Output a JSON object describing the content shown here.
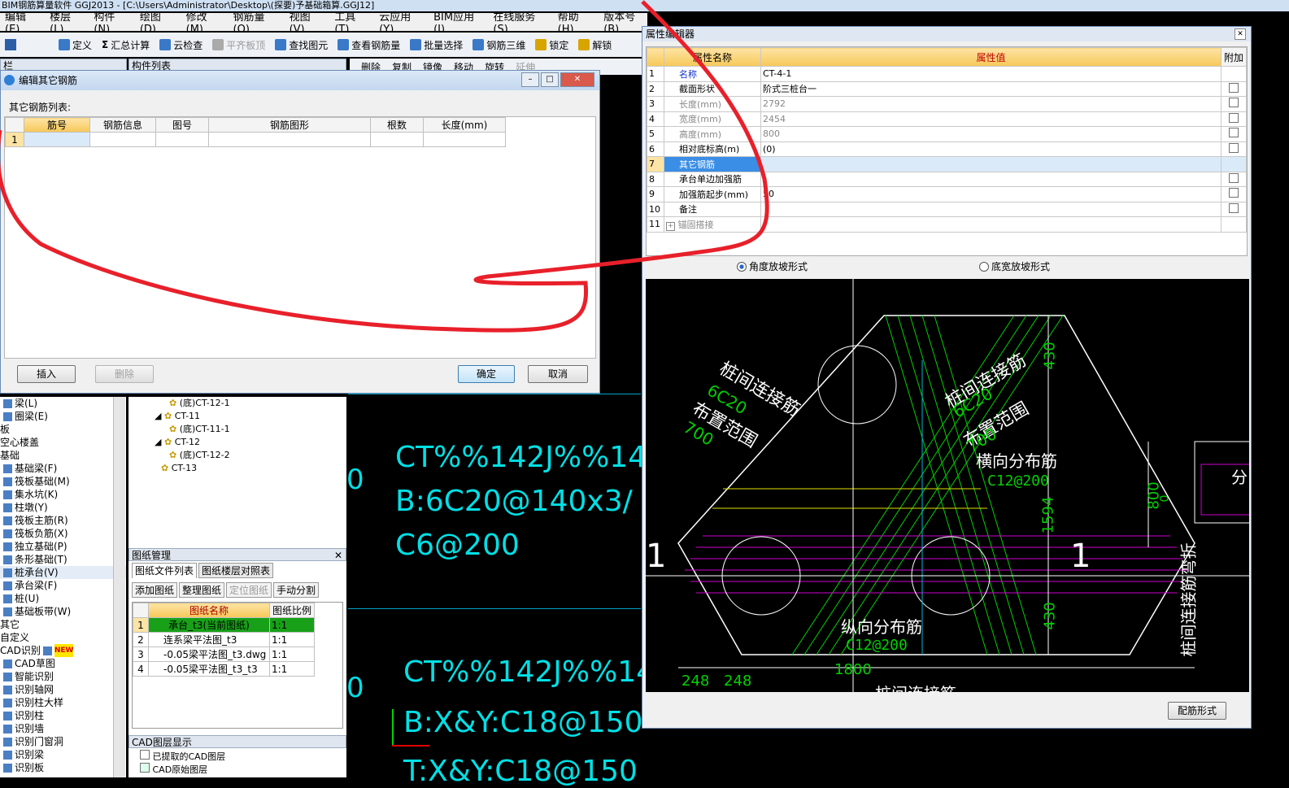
{
  "window_title": "BIM钢筋算量软件 GGJ2013 - [C:\\Users\\Administrator\\Desktop\\(探要)予基础箱算.GGJ12]",
  "menu": [
    "编辑(E)",
    "楼层(L)",
    "构件(N)",
    "绘图(D)",
    "修改(M)",
    "钢筋量(Q)",
    "视图(V)",
    "工具(T)",
    "云应用(Y)",
    "BIM应用(I)",
    "在线服务(S)",
    "帮助(H)",
    "版本号(B)"
  ],
  "toolbar": [
    "定义",
    "汇总计算",
    "云检查",
    "平齐板顶",
    "查找图元",
    "查看钢筋量",
    "批量选择",
    "钢筋三维",
    "锁定",
    "解锁"
  ],
  "toolbar2": [
    "删除",
    "复制",
    "镜像",
    "移动",
    "旋转",
    "延伸"
  ],
  "component_list": {
    "title": "构件列表"
  },
  "left_panel_header": "栏",
  "dialog": {
    "title": "编辑其它钢筋",
    "list_label": "其它钢筋列表:",
    "columns": [
      "筋号",
      "钢筋信息",
      "图号",
      "钢筋图形",
      "根数",
      "长度(mm)"
    ],
    "row_number": "1",
    "buttons": {
      "insert": "插入",
      "delete": "删除",
      "ok": "确定",
      "cancel": "取消"
    }
  },
  "tree_items": [
    "(底)CT-12-1",
    "CT-11",
    "(底)CT-11-1",
    "CT-12",
    "(底)CT-12-2",
    "CT-13"
  ],
  "left_nav": [
    "梁(L)",
    "圈梁(E)",
    "板",
    "空心楼盖",
    "基础",
    "基础梁(F)",
    "筏板基础(M)",
    "集水坑(K)",
    "柱墩(Y)",
    "筏板主筋(R)",
    "筏板负筋(X)",
    "独立基础(P)",
    "条形基础(T)",
    "桩承台(V)",
    "承台梁(F)",
    "桩(U)",
    "基础板带(W)",
    "其它",
    "自定义",
    "CAD识别",
    "CAD草图",
    "智能识别",
    "识别轴网",
    "识别柱大样",
    "识别柱",
    "识别墙",
    "识别门窗洞",
    "识别梁",
    "识别板"
  ],
  "new_badge": "NEW",
  "drawing_mgmt": {
    "title": "图纸管理",
    "tabs": [
      "图纸文件列表",
      "图纸楼层对照表"
    ],
    "tools": [
      "添加图纸",
      "整理图纸",
      "定位图纸",
      "手动分割"
    ],
    "columns": [
      "图纸名称",
      "图纸比例"
    ],
    "rows": [
      {
        "n": "1",
        "name": "承台_t3(当前图纸)",
        "scale": "1:1"
      },
      {
        "n": "2",
        "name": "连系梁平法图_t3",
        "scale": "1:1"
      },
      {
        "n": "3",
        "name": "-0.05梁平法图_t3.dwg",
        "scale": "1:1"
      },
      {
        "n": "4",
        "name": "-0.05梁平法图_t3_t3",
        "scale": "1:1"
      }
    ]
  },
  "cad_layer": {
    "title": "CAD图层显示",
    "items": [
      "已提取的CAD图层",
      "CAD原始图层"
    ]
  },
  "cad_texts": {
    "line1": "CT%%142J%%14",
    "line2": "B:6C20@140x3/",
    "line3": "C6@200",
    "line4": "CT%%142J%%14",
    "line5": "B:X&Y:C18@150",
    "line6": "T:X&Y:C18@150",
    "digit": "0"
  },
  "props": {
    "title": "属性编辑器",
    "columns": [
      "属性名称",
      "属性值",
      "附加"
    ],
    "rows": [
      {
        "n": "1",
        "name": "名称",
        "value": "CT-4-1",
        "check": false
      },
      {
        "n": "2",
        "name": "截面形状",
        "value": "阶式三桩台一",
        "check": true
      },
      {
        "n": "3",
        "name": "长度(mm)",
        "value": "2792",
        "check": true
      },
      {
        "n": "4",
        "name": "宽度(mm)",
        "value": "2454",
        "check": true
      },
      {
        "n": "5",
        "name": "高度(mm)",
        "value": "800",
        "check": true
      },
      {
        "n": "6",
        "name": "相对底标高(m)",
        "value": "(0)",
        "check": true
      },
      {
        "n": "7",
        "name": "其它钢筋",
        "value": "",
        "check": false
      },
      {
        "n": "8",
        "name": "承台单边加强筋",
        "value": "",
        "check": true
      },
      {
        "n": "9",
        "name": "加强筋起步(mm)",
        "value": "50",
        "check": true
      },
      {
        "n": "10",
        "name": "备注",
        "value": "",
        "check": true
      },
      {
        "n": "11",
        "name": "锚固搭接",
        "value": "",
        "check": false
      }
    ],
    "radio_angle": "角度放坡形式",
    "radio_width": "底宽放坡形式",
    "button": "配筋形式"
  },
  "diagram": {
    "label_left1": "桩间连接筋",
    "label_left2": "6C20",
    "label_left3": "布置范围",
    "label_left4": "700",
    "label_right1": "桩间连接筋",
    "label_right2": "6C20",
    "label_right3": "布置范围",
    "label_right4": "700",
    "label_horiz": "横向分布筋",
    "label_horiz_val": "C12@200",
    "label_vert": "纵向分布筋",
    "label_vert_val": "C12@200",
    "dim_430_top": "430",
    "dim_1594": "1594",
    "dim_430_bot": "430",
    "dim_248a": "248",
    "dim_248b": "248",
    "dim_1800": "1800",
    "mark_1": "1",
    "dim_800": "800",
    "dim_0": "0",
    "side_text": "桩间连接筋弯折",
    "side_fen": "分",
    "bottom_partial": "桩间连接筋"
  }
}
